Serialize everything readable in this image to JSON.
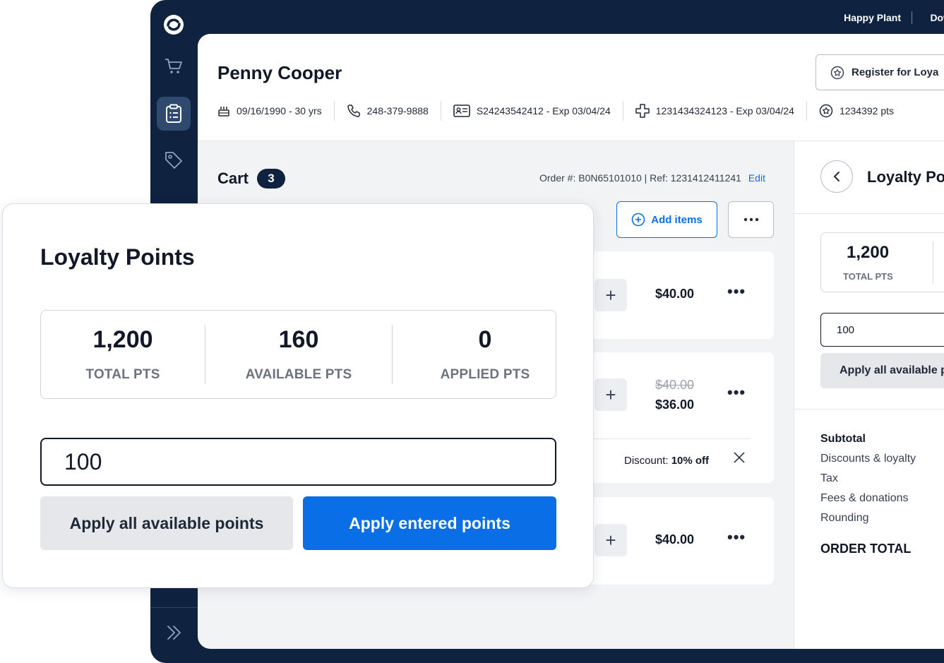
{
  "topbar": {
    "store_name": "Happy Plant",
    "link": "Dow"
  },
  "rail": {
    "items": [
      {
        "name": "cart",
        "icon": "cart-icon"
      },
      {
        "name": "orders",
        "icon": "clipboard-list-icon",
        "active": true
      },
      {
        "name": "tags",
        "icon": "tag-icon"
      }
    ],
    "expand_icon": "double-chevron-right-icon"
  },
  "customer": {
    "name": "Penny Cooper",
    "register_label": "Register for Loya",
    "dob": "09/16/1990 - 30 yrs",
    "phone": "248-379-9888",
    "id_card": "S24243542412 - Exp 03/04/24",
    "medical": "1231434324123 - Exp 03/04/24",
    "points": "1234392 pts"
  },
  "cart": {
    "title": "Cart",
    "count": "3",
    "order_meta": "Order #: B0N65101010  |  Ref: 1231412411241",
    "edit_label": "Edit",
    "add_items_label": "Add items",
    "items": [
      {
        "price": "$40.00"
      },
      {
        "old_price": "$40.00",
        "price": "$36.00",
        "discount_label": "Discount:",
        "discount_value": "10% off"
      },
      {
        "price": "$40.00"
      }
    ]
  },
  "right_panel": {
    "title": "Loyalty Po",
    "total_value": "1,200",
    "total_label": "TOTAL PTS",
    "input_value": "100",
    "apply_all_label": "Apply all available p",
    "summary": {
      "subtotal": "Subtotal",
      "discounts": "Discounts & loyalty",
      "tax": "Tax",
      "fees": "Fees & donations",
      "rounding": "Rounding",
      "order_total": "ORDER TOTAL"
    }
  },
  "modal": {
    "title": "Loyalty Points",
    "stats": [
      {
        "value": "1,200",
        "label": "TOTAL PTS"
      },
      {
        "value": "160",
        "label": "AVAILABLE PTS"
      },
      {
        "value": "0",
        "label": "APPLIED PTS"
      }
    ],
    "input_value": "100",
    "apply_all_label": "Apply all available points",
    "apply_entered_label": "Apply entered points"
  },
  "colors": {
    "navy": "#0f2340",
    "primary_blue": "#0a6fe6",
    "muted_button": "#e5e7eb",
    "panel_bg": "#f2f3f5"
  }
}
